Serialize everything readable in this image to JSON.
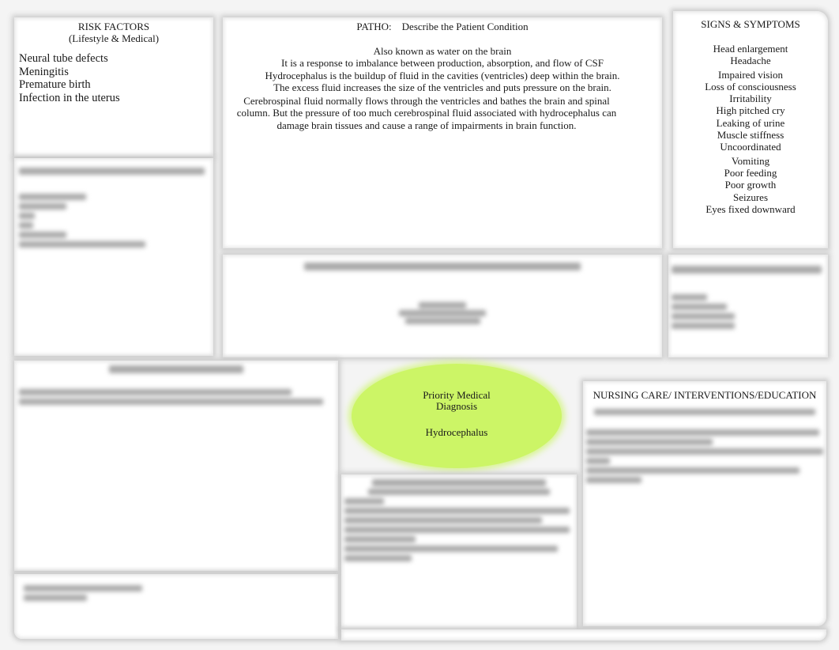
{
  "risk_factors": {
    "title": "RISK FACTORS",
    "subtitle": "(Lifestyle & Medical)",
    "items": [
      "Neural tube defects",
      "Meningitis",
      "Premature birth",
      "Infection in the uterus"
    ]
  },
  "patho": {
    "title": "PATHO:    Describe the Patient Condition",
    "lines": [
      "Also known as water on the brain",
      "It is a response to imbalance between production, absorption, and flow of CSF",
      "Hydrocephalus is the buildup of fluid in the cavities (ventricles) deep within the brain. The excess fluid increases the size of the ventricles and puts pressure on the brain.",
      "Cerebrospinal fluid normally flows through the ventricles and bathes the brain and spinal column. But the pressure of too much cerebrospinal fluid associated with hydrocephalus can damage brain tissues and cause a range of impairments in brain function."
    ]
  },
  "signs_symptoms": {
    "title": "SIGNS & SYMPTOMS",
    "items": [
      "Head enlargement",
      "Headache",
      "Impaired vision",
      "Loss of consciousness",
      "Irritability",
      "High pitched cry",
      "Leaking of urine",
      "Muscle stiffness",
      "Uncoordinated",
      "Vomiting",
      "Poor feeding",
      "Poor growth",
      "Seizures",
      "Eyes fixed downward"
    ]
  },
  "priority_diagnosis": {
    "label_line1": "Priority Medical",
    "label_line2": "Diagnosis",
    "value": "Hydrocephalus",
    "color": "#ccf566"
  },
  "nursing_care": {
    "title": "NURSING CARE/ INTERVENTIONS/EDUCATION"
  }
}
